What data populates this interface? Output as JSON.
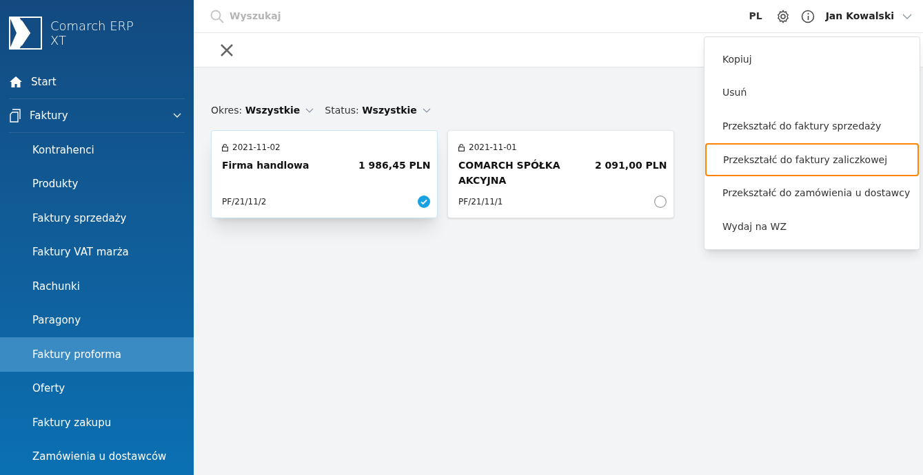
{
  "app": {
    "name": "Comarch ERP XT"
  },
  "sidebar": {
    "items": [
      {
        "label": "Start",
        "kind": "home",
        "selected": false
      },
      {
        "label": "Faktury",
        "kind": "documents",
        "selected": false,
        "expanded": true,
        "children": [
          {
            "label": "Kontrahenci",
            "selected": false
          },
          {
            "label": "Produkty",
            "selected": false
          },
          {
            "label": "Faktury sprzedaży",
            "selected": false
          },
          {
            "label": "Faktury VAT marża",
            "selected": false
          },
          {
            "label": "Rachunki",
            "selected": false
          },
          {
            "label": "Paragony",
            "selected": false
          },
          {
            "label": "Faktury proforma",
            "selected": true
          },
          {
            "label": "Oferty",
            "selected": false
          },
          {
            "label": "Faktury zakupu",
            "selected": false
          },
          {
            "label": "Zamówienia u dostawców",
            "selected": false
          }
        ]
      }
    ]
  },
  "topbar": {
    "search": {
      "placeholder": "Wyszukaj"
    },
    "language": "PL",
    "user": "Jan Kowalski"
  },
  "filters": [
    {
      "label": "Okres:",
      "value": "Wszystkie"
    },
    {
      "label": "Status:",
      "value": "Wszystkie"
    }
  ],
  "cards": [
    {
      "date": "2021-11-02",
      "name": "Firma handlowa",
      "amount": "1 986,45 PLN",
      "number": "PF/21/11/2",
      "selected": true
    },
    {
      "date": "2021-11-01",
      "name": "COMARCH SPÓŁKA AKCYJNA",
      "amount": "2 091,00 PLN",
      "number": "PF/21/11/1",
      "selected": false
    }
  ],
  "context_menu": {
    "items": [
      {
        "label": "Kopiuj",
        "highlighted": false
      },
      {
        "label": "Usuń",
        "highlighted": false
      },
      {
        "label": "Przekształć do faktury sprzedaży",
        "highlighted": false
      },
      {
        "label": "Przekształć do faktury zaliczkowej",
        "highlighted": true
      },
      {
        "label": "Przekształć do zamówienia u dostawcy",
        "highlighted": false
      },
      {
        "label": "Wydaj na WZ",
        "highlighted": false
      }
    ]
  }
}
